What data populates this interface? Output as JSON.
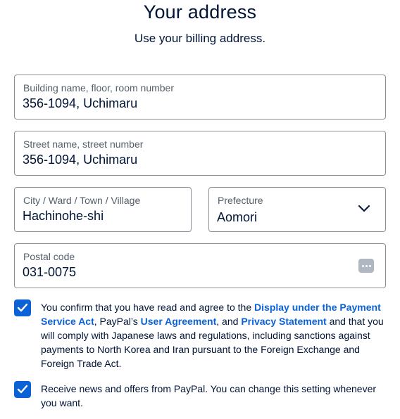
{
  "header": {
    "title": "Your address",
    "subtitle": "Use your billing address."
  },
  "form": {
    "building": {
      "label": "Building name, floor, room number",
      "value": "356-1094, Uchimaru"
    },
    "street": {
      "label": "Street name, street number",
      "value": "356-1094, Uchimaru"
    },
    "city": {
      "label": "City / Ward / Town / Village",
      "value": "Hachinohe-shi"
    },
    "prefecture": {
      "label": "Prefecture",
      "value": "Aomori",
      "icon": "chevron-down-icon"
    },
    "postal": {
      "label": "Postal code",
      "value": "031-0075",
      "icon": "password-manager-icon"
    }
  },
  "consent": {
    "checked": true,
    "text_1": "You confirm that you have read and agree to the ",
    "link_1": "Display under the Payment Service Act",
    "text_2": ", PayPal’s ",
    "link_2": "User Agreement",
    "text_3": ", and ",
    "link_3": "Privacy Statement",
    "text_4": " and that you will comply with Japanese laws and regulations, including sanctions against payments to North Korea and Iran pursuant to the Foreign Exchange and Foreign Trade Act."
  },
  "news": {
    "checked": true,
    "text": "Receive news and offers from PayPal. You can change this setting whenever you want."
  },
  "colors": {
    "accent": "#0b62d6",
    "text": "#001435",
    "label": "#545d68",
    "border": "#8a8f99"
  }
}
